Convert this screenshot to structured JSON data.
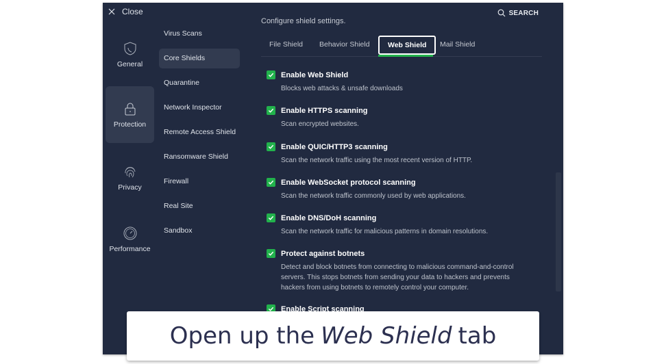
{
  "window": {
    "close_label": "Close",
    "search_label": "SEARCH"
  },
  "nav": {
    "items": [
      {
        "label": "General",
        "icon": "shield-icon",
        "active": false
      },
      {
        "label": "Protection",
        "icon": "lock-icon",
        "active": true
      },
      {
        "label": "Privacy",
        "icon": "fingerprint-icon",
        "active": false
      },
      {
        "label": "Performance",
        "icon": "gauge-icon",
        "active": false
      }
    ]
  },
  "submenu": {
    "items": [
      {
        "label": "Virus Scans",
        "active": false
      },
      {
        "label": "Core Shields",
        "active": true
      },
      {
        "label": "Quarantine",
        "active": false
      },
      {
        "label": "Network Inspector",
        "active": false
      },
      {
        "label": "Remote Access Shield",
        "active": false
      },
      {
        "label": "Ransomware Shield",
        "active": false
      },
      {
        "label": "Firewall",
        "active": false
      },
      {
        "label": "Real Site",
        "active": false
      },
      {
        "label": "Sandbox",
        "active": false
      }
    ]
  },
  "content": {
    "configure_text": "Configure shield settings.",
    "tabs": [
      {
        "label": "File Shield",
        "active": false
      },
      {
        "label": "Behavior Shield",
        "active": false
      },
      {
        "label": "Web Shield",
        "active": true
      },
      {
        "label": "Mail Shield",
        "active": false
      }
    ],
    "options": [
      {
        "title": "Enable Web Shield",
        "desc": "Blocks web attacks & unsafe downloads",
        "checked": true
      },
      {
        "title": "Enable HTTPS scanning",
        "desc": "Scan encrypted websites.",
        "checked": true
      },
      {
        "title": "Enable QUIC/HTTP3 scanning",
        "desc": "Scan the network traffic using the most recent version of HTTP.",
        "checked": true
      },
      {
        "title": "Enable WebSocket protocol scanning",
        "desc": "Scan the network traffic commonly used by web applications.",
        "checked": true
      },
      {
        "title": "Enable DNS/DoH scanning",
        "desc": "Scan the network traffic for malicious patterns in domain resolutions.",
        "checked": true
      },
      {
        "title": "Protect against botnets",
        "desc": "Detect and block botnets from connecting to malicious command-and-control servers. This stops botnets from sending your data to hackers and prevents hackers from using botnets to remotely control your computer.",
        "checked": true
      },
      {
        "title": "Enable Script scanning",
        "desc": "",
        "checked": true
      }
    ]
  },
  "caption": {
    "prefix": "Open up the",
    "emphasis": "Web Shield",
    "suffix": "tab"
  },
  "colors": {
    "background": "#212a40",
    "accent_green": "#22b24c",
    "active_item": "#323b50"
  }
}
